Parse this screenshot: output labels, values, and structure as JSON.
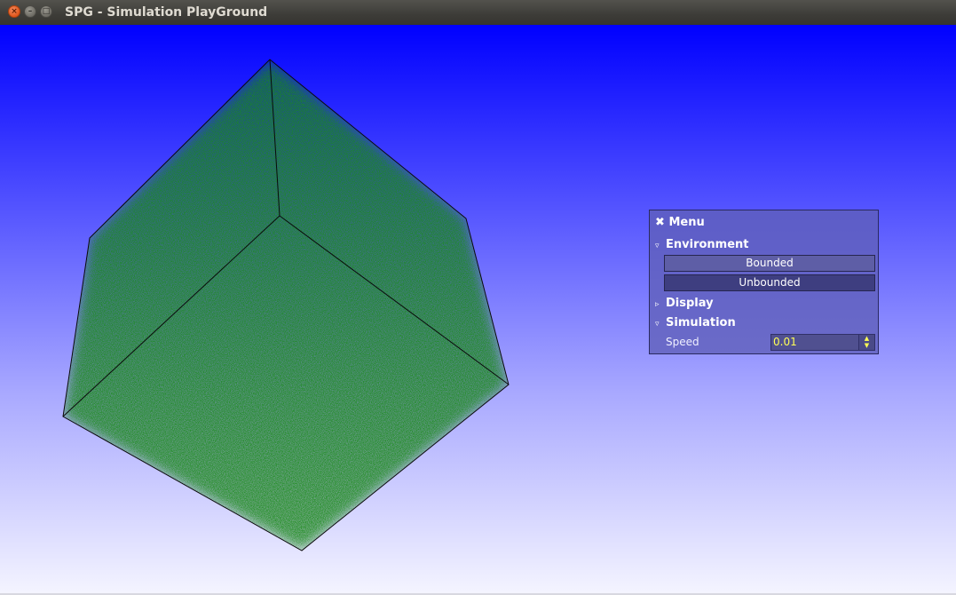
{
  "window": {
    "title": "SPG - Simulation PlayGround",
    "close_glyph": "×",
    "minimize_glyph": "–",
    "maximize_glyph": "□"
  },
  "scene": {
    "object": "cube",
    "particle_color": "#1f9a1f",
    "edge_color": "#0a0a0a",
    "background_top": "#0000ff",
    "background_bottom": "#f4f4ff"
  },
  "menu": {
    "title": "Menu",
    "close_glyph": "✖",
    "sections": {
      "environment": {
        "label": "Environment",
        "expanded_glyph": "▿",
        "buttons": [
          "Bounded",
          "Unbounded"
        ]
      },
      "display": {
        "label": "Display",
        "collapsed_glyph": "▹"
      },
      "simulation": {
        "label": "Simulation",
        "expanded_glyph": "▿",
        "speed_label": "Speed",
        "speed_value": "0.01"
      }
    },
    "spin_up": "▲",
    "spin_down": "▼"
  }
}
